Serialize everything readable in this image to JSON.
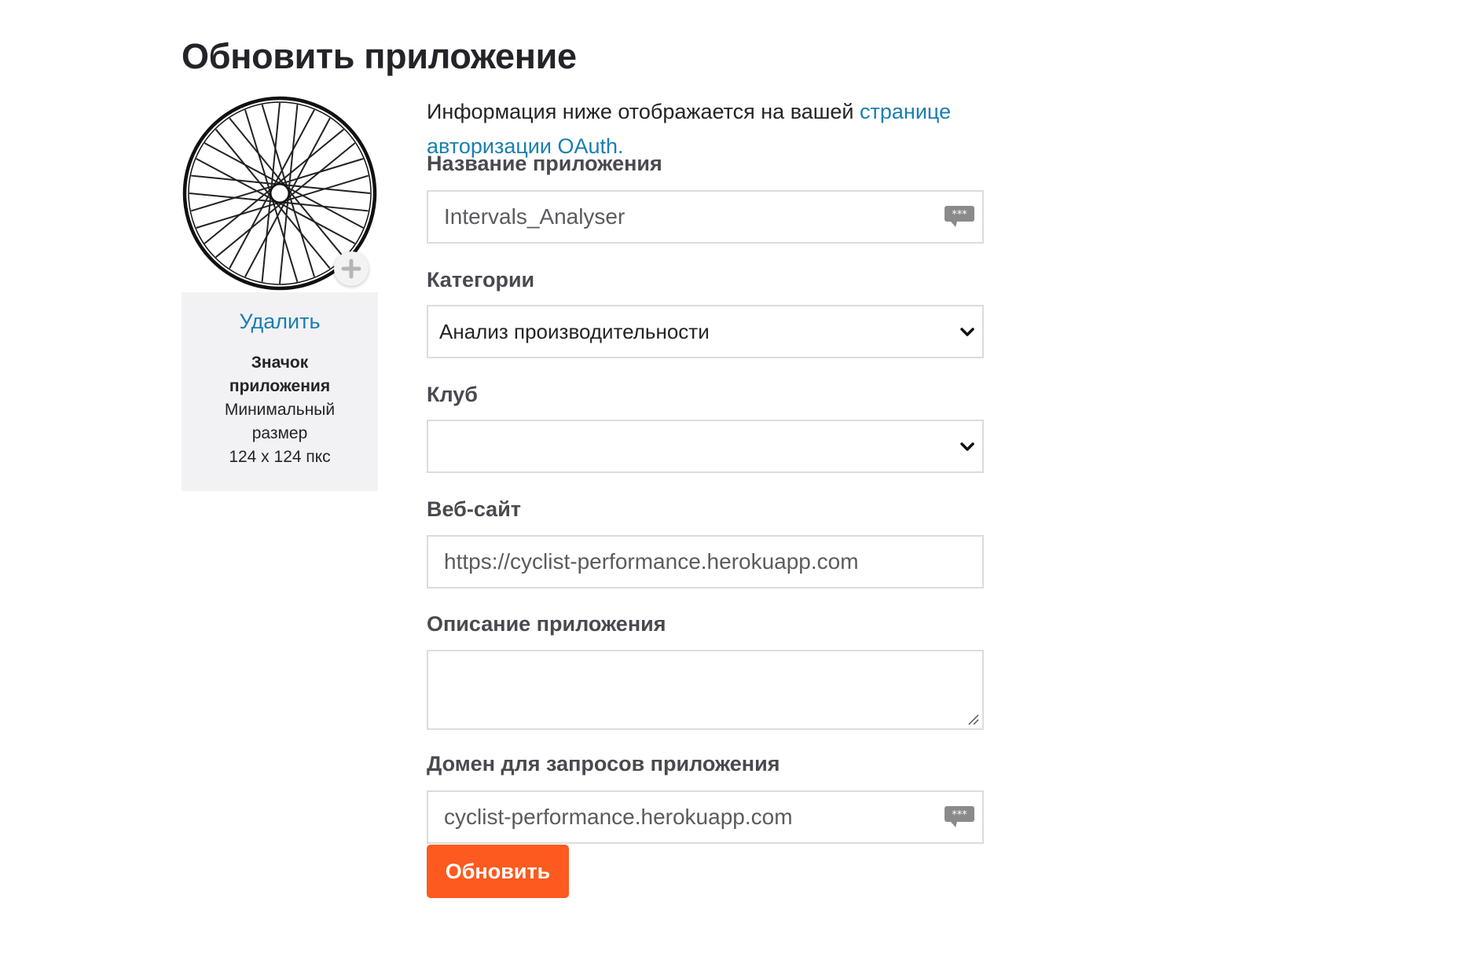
{
  "page": {
    "title": "Обновить приложение"
  },
  "icon_panel": {
    "delete_label": "Удалить",
    "title": "Значок приложения",
    "hint_line1": "Минимальный размер",
    "hint_line2": "124 x 124 пкс",
    "icons": {
      "add": "add-photo-icon",
      "wheel": "bike-wheel-icon"
    }
  },
  "intro": {
    "text": "Информация ниже отображается на вашей ",
    "link_text": "странице авторизации OAuth."
  },
  "form": {
    "app_name": {
      "label": "Название приложения",
      "value": "Intervals_Analyser"
    },
    "category": {
      "label": "Категории",
      "value": "Анализ производительности"
    },
    "club": {
      "label": "Клуб",
      "value": ""
    },
    "website": {
      "label": "Веб-сайт",
      "value": "https://cyclist-performance.herokuapp.com"
    },
    "description": {
      "label": "Описание приложения",
      "value": ""
    },
    "callback_domain": {
      "label": "Домен для запросов приложения",
      "value": "cyclist-performance.herokuapp.com"
    },
    "submit_label": "Обновить"
  },
  "colors": {
    "accent": "#fc5a1f",
    "link": "#1a7fb0",
    "panel_bg": "#f2f2f4"
  }
}
